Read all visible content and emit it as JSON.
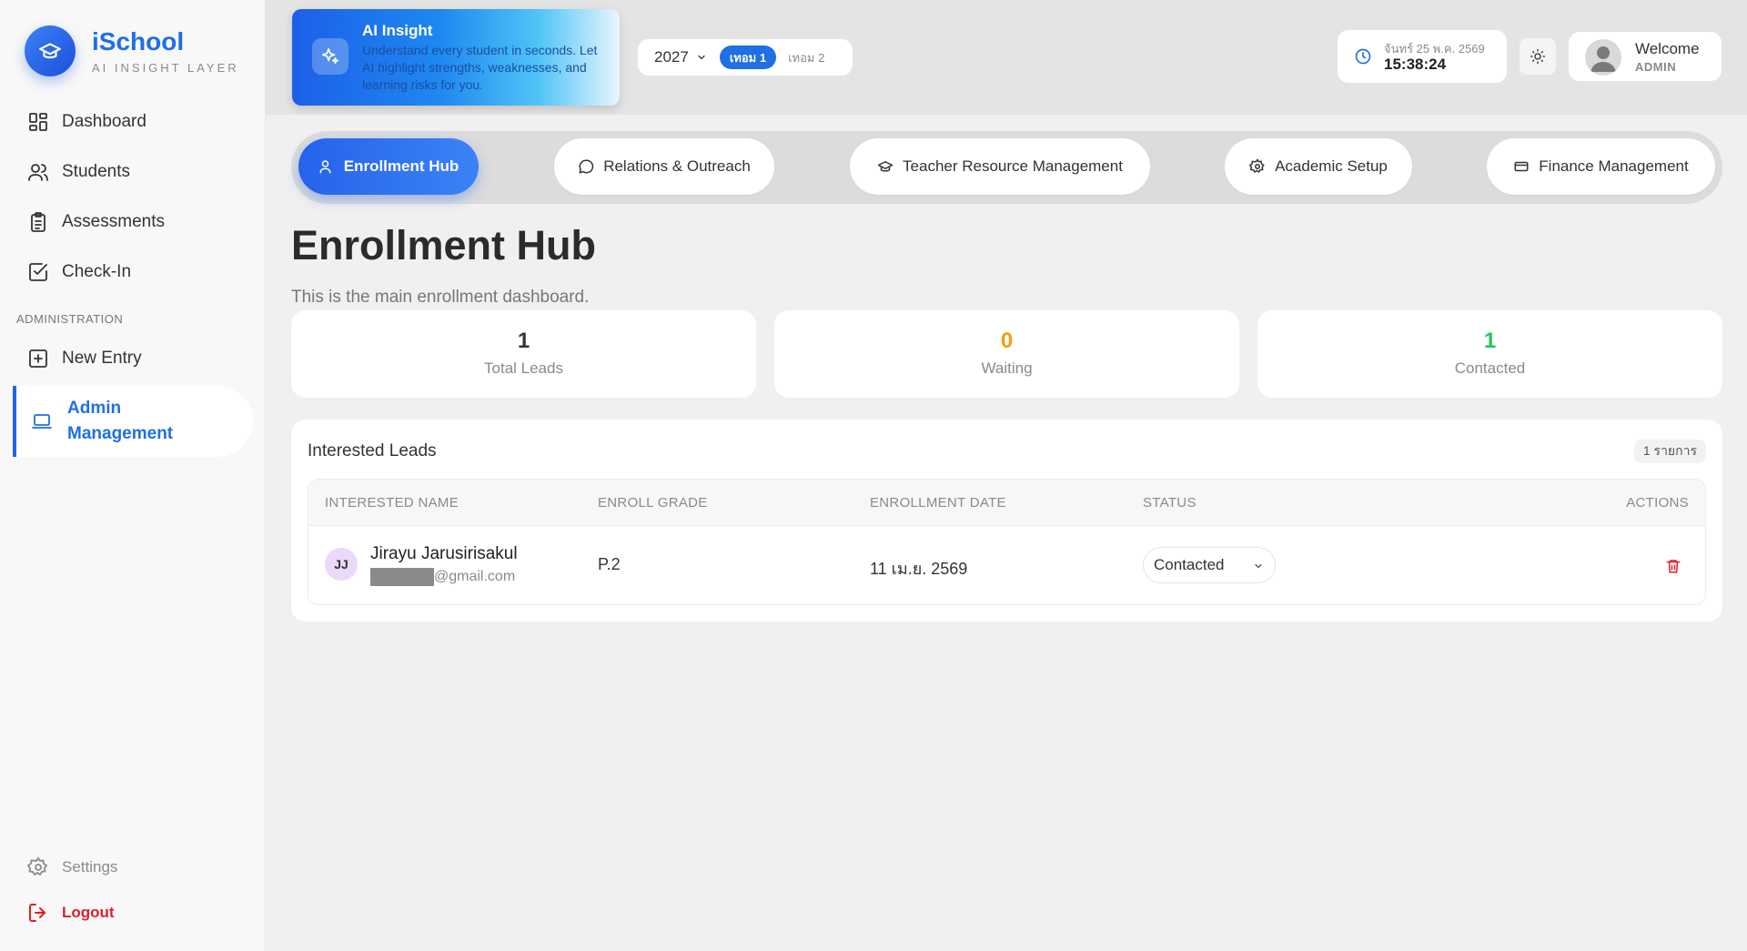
{
  "brand": {
    "name": "iSchool",
    "subtitle": "AI INSIGHT LAYER"
  },
  "sidebar": {
    "items": [
      {
        "label": "Dashboard",
        "icon": "dashboard-icon"
      },
      {
        "label": "Students",
        "icon": "users-icon"
      },
      {
        "label": "Assessments",
        "icon": "clipboard-icon"
      },
      {
        "label": "Check-In",
        "icon": "checkbox-icon"
      }
    ],
    "section_label": "ADMINISTRATION",
    "admin_items": [
      {
        "label": "New Entry",
        "icon": "plus-square-icon"
      },
      {
        "label": "Admin Management",
        "icon": "laptop-icon",
        "active": true
      }
    ],
    "settings_label": "Settings",
    "logout_label": "Logout"
  },
  "ai_insight": {
    "title": "AI Insight",
    "description": "Understand every student in seconds. Let AI highlight strengths, weaknesses, and learning risks for you."
  },
  "term_selector": {
    "year": "2027",
    "terms": [
      "เทอม 1",
      "เทอม 2"
    ],
    "active_term": "เทอม 1"
  },
  "clock": {
    "date": "จันทร์ 25 พ.ค. 2569",
    "time": "15:38:24"
  },
  "user": {
    "welcome": "Welcome",
    "role": "ADMIN"
  },
  "tabs": [
    {
      "label": "Enrollment Hub",
      "icon": "user-icon",
      "active": true
    },
    {
      "label": "Relations & Outreach",
      "icon": "chat-icon"
    },
    {
      "label": "Teacher Resource Management",
      "icon": "graduation-cap-icon"
    },
    {
      "label": "Academic Setup",
      "icon": "gear-icon"
    },
    {
      "label": "Finance Management",
      "icon": "credit-card-icon"
    }
  ],
  "page": {
    "title": "Enrollment Hub",
    "description": "This is the main enrollment dashboard."
  },
  "stats": [
    {
      "value": "1",
      "label": "Total Leads",
      "color": "#333333"
    },
    {
      "value": "0",
      "label": "Waiting",
      "color": "#f59e0b"
    },
    {
      "value": "1",
      "label": "Contacted",
      "color": "#22c55e"
    }
  ],
  "leads": {
    "title": "Interested Leads",
    "count_badge": "1 รายการ",
    "columns": [
      "INTERESTED NAME",
      "ENROLL GRADE",
      "ENROLLMENT DATE",
      "STATUS",
      "ACTIONS"
    ],
    "rows": [
      {
        "initials": "JJ",
        "name": "Jirayu Jarusirisakul",
        "email_suffix": "@gmail.com",
        "grade": "P.2",
        "date": "11 เม.ย. 2569",
        "status": "Contacted"
      }
    ]
  },
  "colors": {
    "accent": "#1f6fe5",
    "danger": "#e11d2a",
    "waiting": "#f59e0b",
    "contacted": "#22c55e"
  }
}
